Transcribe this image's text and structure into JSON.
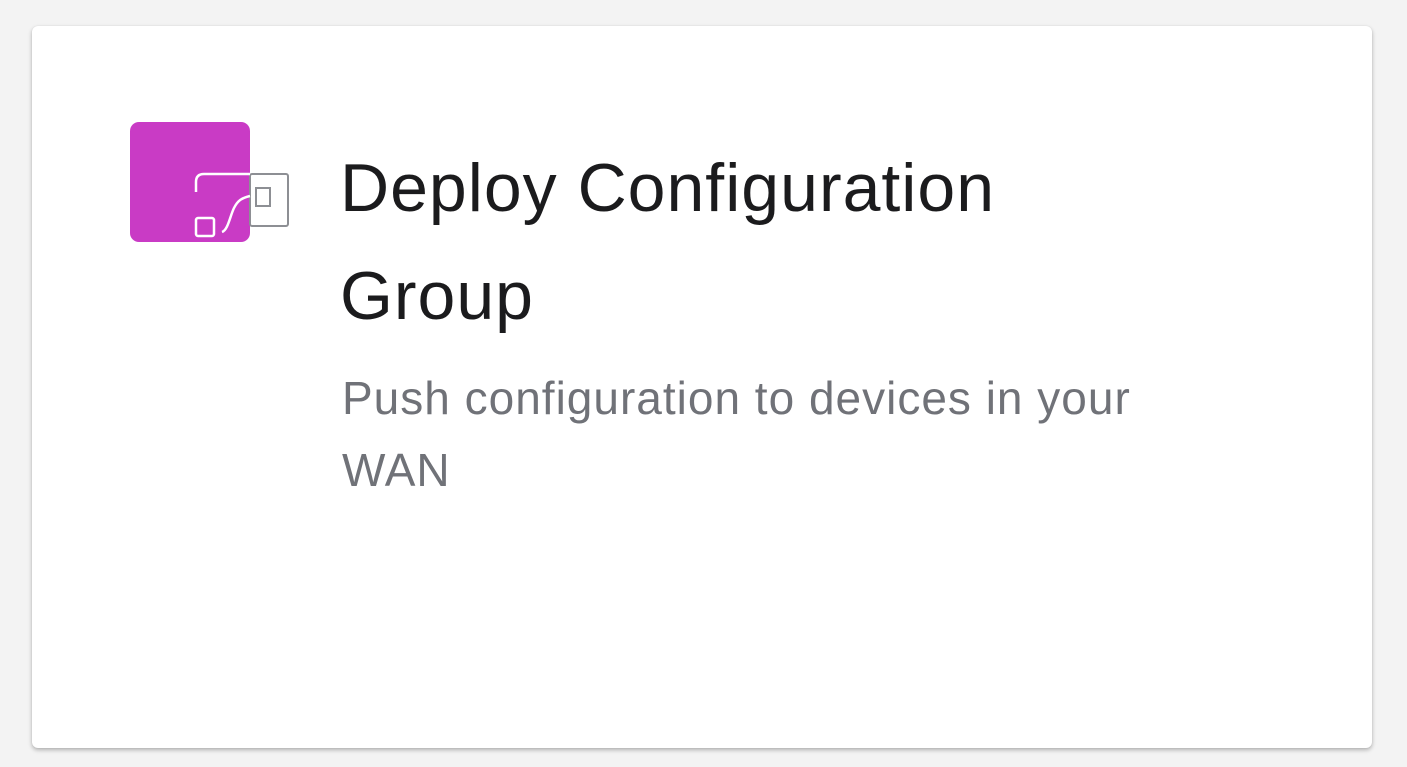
{
  "card": {
    "icon": "configuration-group-icon",
    "icon_color": "#c93bc5",
    "title": "Deploy Configuration Group",
    "description": "Push configuration to devices in your WAN"
  }
}
